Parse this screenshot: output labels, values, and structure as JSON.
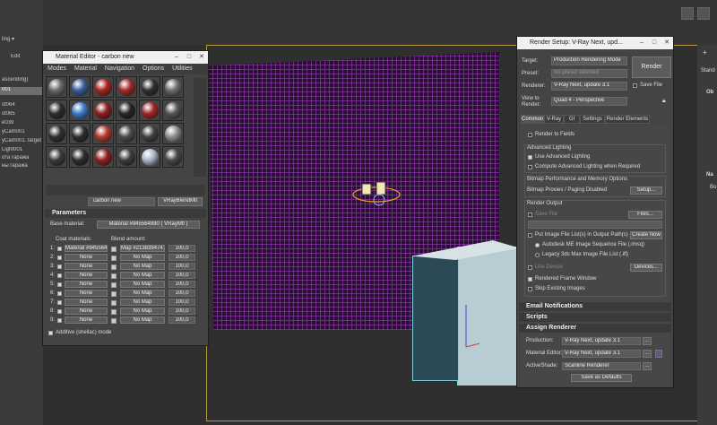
{
  "sidebar": {
    "labels": [
      "ling ▾",
      "Edit",
      "ascending)",
      "001",
      "ct064",
      "ct065",
      "e039",
      "yCam001",
      "yCam001.Target",
      "Light001",
      "ота гаража",
      "ны гаража"
    ]
  },
  "material_editor": {
    "title": "Material Editor - carbon new",
    "menu": [
      "Modes",
      "Material",
      "Navigation",
      "Options",
      "Utilities"
    ],
    "material_name": "carbon new",
    "material_type": "VRayBlendMtl",
    "parameters_title": "Parameters",
    "base_material_label": "Base material:",
    "base_material_value": "Material #945564890 ( VRayMtl )",
    "coat_label": "Coat materials:",
    "blend_label": "Blend amount:",
    "rows": [
      {
        "num": "1:",
        "coat": "Material #945564890",
        "blend": "Map #2138394741",
        "amount": "100,0"
      },
      {
        "num": "2:",
        "coat": "None",
        "blend": "No Map",
        "amount": "100,0"
      },
      {
        "num": "3:",
        "coat": "None",
        "blend": "No Map",
        "amount": "100,0"
      },
      {
        "num": "4:",
        "coat": "None",
        "blend": "No Map",
        "amount": "100,0"
      },
      {
        "num": "5:",
        "coat": "None",
        "blend": "No Map",
        "amount": "100,0"
      },
      {
        "num": "6:",
        "coat": "None",
        "blend": "No Map",
        "amount": "100,0"
      },
      {
        "num": "7:",
        "coat": "None",
        "blend": "No Map",
        "amount": "100,0"
      },
      {
        "num": "8:",
        "coat": "None",
        "blend": "No Map",
        "amount": "100,0"
      },
      {
        "num": "9:",
        "coat": "None",
        "blend": "No Map",
        "amount": "100,0"
      }
    ],
    "additive_label": "Additive (shellac) mode",
    "sphere_colors": [
      "#6c6c6c",
      "#3a5f9a",
      "#a8221f",
      "#a12a2a",
      "#2f2f2f",
      "#6d6d6d",
      "#2d2d2d",
      "#3e7ac6",
      "#8c1e1e",
      "#262626",
      "#9f2626",
      "#555555",
      "#303030",
      "#2d2d2d",
      "#b23a2a",
      "#4b4b4b",
      "#3f3f3f",
      "#8c8c8c",
      "#3b3b3b",
      "#2c2c2c",
      "#8f1f1f",
      "#3c3c3c",
      "#a9b5c5",
      "#474747"
    ]
  },
  "render_setup": {
    "title": "Render Setup: V-Ray Next, upd...",
    "target_label": "Target:",
    "target_value": "Production Rendering Mode",
    "preset_label": "Preset:",
    "preset_value": "No preset selected",
    "renderer_label": "Renderer:",
    "renderer_value": "V-Ray Next, update 3.1",
    "save_file_label": "Save File",
    "view_label": "View to\nRender:",
    "view_value": "Quad 4 - Perspective",
    "render_button": "Render",
    "tabs": [
      "Common",
      "V-Ray",
      "GI",
      "Settings",
      "Render Elements"
    ],
    "render_to_fields": "Render to Fields",
    "advanced_lighting_title": "Advanced Lighting",
    "use_advanced_lighting": "Use Advanced Lighting",
    "compute_advanced_lighting": "Compute Advanced Lighting when Required",
    "bitmap_title": "Bitmap Performance and Memory Options",
    "bitmap_value": "Bitmap Proxies / Paging Disabled",
    "setup_button": "Setup...",
    "render_output_title": "Render Output",
    "save_file_chk": "Save File",
    "files_button": "Files...",
    "put_image_file": "Put Image File List(s) in Output Path(s)",
    "create_now": "Create Now",
    "autodesk_seq": "Autodesk ME Image Sequence File (.imsq)",
    "legacy_seq": "Legacy 3ds Max Image File List (.ifl)",
    "use_device": "Use Device",
    "devices_button": "Devices...",
    "rendered_frame_window": "Rendered Frame Window",
    "skip_existing": "Skip Existing Images",
    "email_notifications": "Email Notifications",
    "scripts": "Scripts",
    "assign_renderer": "Assign Renderer",
    "production_label": "Production:",
    "production_value": "V-Ray Next, update 3.1",
    "mat_editor_label": "Material Editor:",
    "mat_editor_value": "V-Ray Next, update 3.1",
    "activeshade_label": "ActiveShade:",
    "activeshade_value": "Scanline Renderer",
    "save_defaults": "Save as Defaults"
  },
  "command_panel": {
    "labels": [
      "Stand",
      "Ob",
      "Na",
      "Bo"
    ]
  }
}
